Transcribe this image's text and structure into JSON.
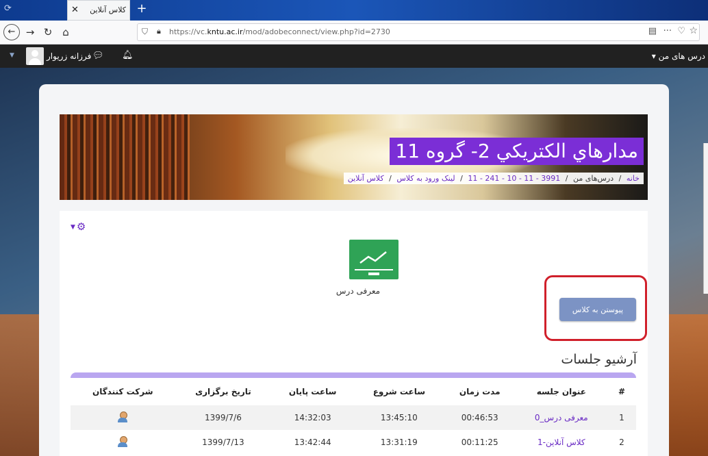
{
  "browser": {
    "tab_title": "کلاس آنلاین",
    "new_tab": "+",
    "url_prefix": "https://vc.",
    "url_domain": "kntu.ac.ir",
    "url_path": "/mod/adobeconnect/view.php?id=2730"
  },
  "topbar": {
    "username": "فرزانه زریوار",
    "my_courses": "درس های من"
  },
  "header": {
    "course_title": "مدارهاي الكتريكي 2- گروه 11",
    "breadcrumb": [
      "خانه",
      "درس‌های من",
      "3991 - 11 - 10 - 241 - 11",
      "لینک ورود به کلاس",
      "کلاس آنلاین"
    ]
  },
  "activity": {
    "label": "معرفی درس",
    "join_button": "پیوستن به کلاس"
  },
  "archive": {
    "title": "آرشیو جلسات",
    "columns": [
      "#",
      "عنوان جلسه",
      "مدت زمان",
      "ساعت شروع",
      "ساعت پایان",
      "تاریخ برگزاری",
      "شرکت کنندگان"
    ],
    "rows": [
      {
        "num": "1",
        "title": "معرفی درس_0",
        "duration": "00:46:53",
        "start": "13:45:10",
        "end": "14:32:03",
        "date": "1399/7/6"
      },
      {
        "num": "2",
        "title": "کلاس آنلاین-1",
        "duration": "00:11:25",
        "start": "13:31:19",
        "end": "13:42:44",
        "date": "1399/7/13"
      }
    ]
  },
  "colors": {
    "accent": "#6a2bc4",
    "title_bg": "#7b2ed6",
    "join_button": "#7c93c4",
    "highlight": "#d0202b",
    "activity_icon": "#2fa356"
  }
}
